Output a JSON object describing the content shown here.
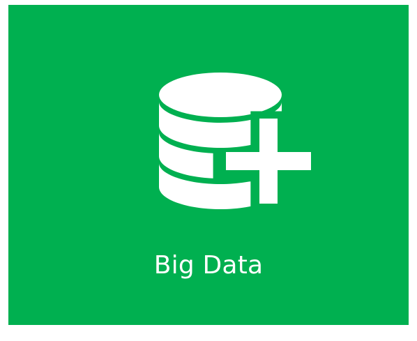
{
  "tile": {
    "label": "Big Data",
    "icon": "database-plus-icon",
    "background_color": "#00b050",
    "foreground_color": "#ffffff"
  }
}
